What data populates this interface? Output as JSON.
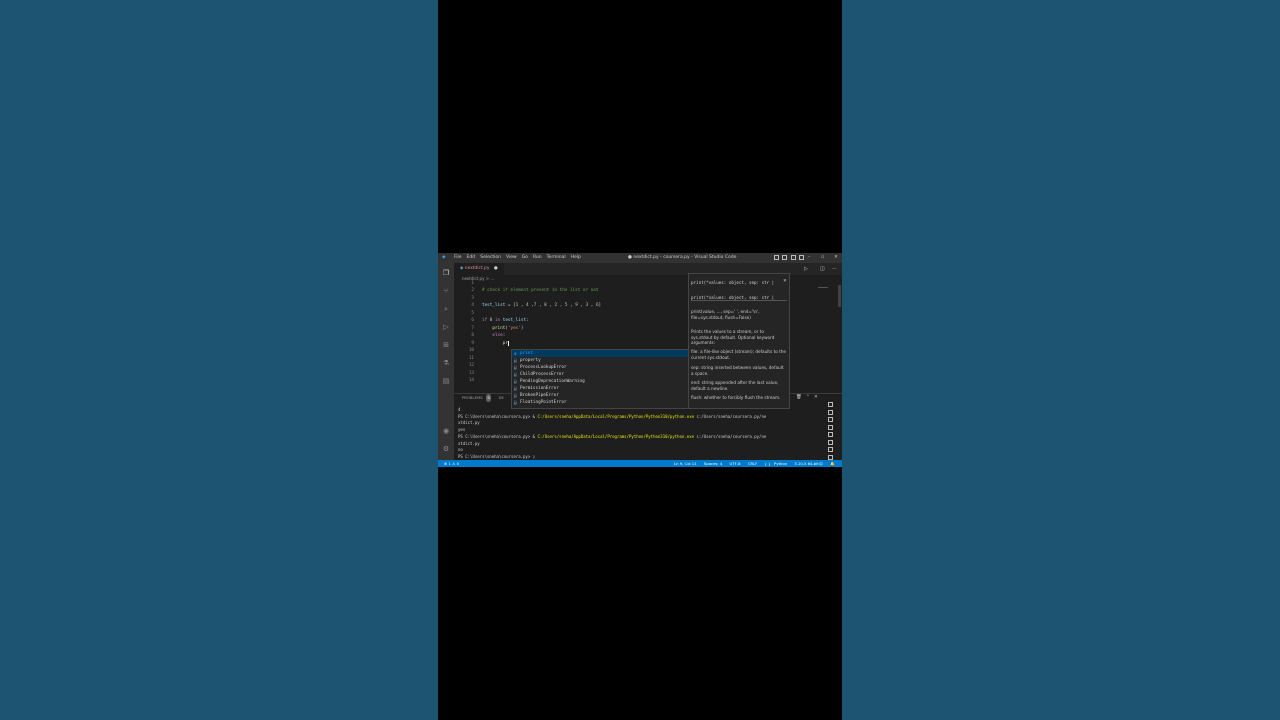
{
  "window": {
    "title": "● nextdict.py - coursera.py - Visual Studio Code",
    "menu": [
      "File",
      "Edit",
      "Selection",
      "View",
      "Go",
      "Run",
      "Terminal",
      "Help"
    ]
  },
  "tab": {
    "label": "nextdict.py"
  },
  "breadcrumb": "nextdict.py > ...",
  "editor": {
    "line_numbers": [
      "1",
      "2",
      "3",
      "4",
      "5",
      "6",
      "7",
      "8",
      "9",
      "10",
      "11",
      "12",
      "13",
      "14"
    ],
    "lines": [
      "",
      "# check if element present in the list or not",
      "",
      "test_list = [1 , 4 ,7 , 8 , 2 , 5 , 9 , 3 , 6]",
      "",
      "if 8 in test_list:",
      "    print('yes')",
      "    else:",
      "        pr",
      "",
      "",
      "",
      "",
      ""
    ]
  },
  "suggestions": {
    "items": [
      "print",
      "property",
      "ProcessLookupError",
      "ChildProcessError",
      "PendingDeprecationWarning",
      "PermissionError",
      "BrokenPipeError",
      "FloatingPointError"
    ]
  },
  "hover": {
    "signature_a": "print(*values: object, sep: str |",
    "signature_b": "print(*values: object, sep: str |",
    "doc_call": "print(value, ..., sep=' ', end='\\n', file=sys.stdout, flush=False)",
    "doc_body": "Prints the values to a stream, or to sys.stdout by default. Optional keyword arguments:",
    "doc_file": "file: a file-like object (stream); defaults to the current sys.stdout.",
    "doc_sep": "sep: string inserted between values, default a space.",
    "doc_end": "end: string appended after the last value, default a newline.",
    "doc_flush": "flush: whether to forcibly flush the stream."
  },
  "panel": {
    "tab_problems": "PROBLEMS",
    "problems_count": "0",
    "tab_debug": "DE",
    "terminal_lines": [
      {
        "pre": "4",
        "path": "",
        "post": ""
      },
      {
        "pre": "PS C:\\Users\\sneha\\coursera.py> & ",
        "path": "C:/Users/sneha/AppData/Local/Programs/Python/Python310/python.exe",
        "post": " c:/Users/sneha/coursera.py/ne"
      },
      {
        "pre": "xtdict.py",
        "path": "",
        "post": ""
      },
      {
        "pre": "yes",
        "path": "",
        "post": ""
      },
      {
        "pre": "PS C:\\Users\\sneha\\coursera.py> & ",
        "path": "C:/Users/sneha/AppData/Local/Programs/Python/Python310/python.exe",
        "post": " c:/Users/sneha/coursera.py/ne"
      },
      {
        "pre": "xtdict.py",
        "path": "",
        "post": ""
      },
      {
        "pre": "no",
        "path": "",
        "post": ""
      },
      {
        "pre": "PS C:\\Users\\sneha\\coursera.py> ▯",
        "path": "",
        "post": ""
      }
    ]
  },
  "status": {
    "problems": "⊗ 1 ⚠ 0",
    "position": "Ln 9, Col 11",
    "spaces": "Spaces: 4",
    "encoding": "UTF-8",
    "eol": "CRLF",
    "language_braces": "{ }",
    "language": "Python",
    "interpreter": "3.10.5 64-bit"
  },
  "icons": {
    "explorer": "explorer-icon",
    "scm": "source-control-icon",
    "search": "search-icon",
    "debug": "run-debug-icon",
    "extensions": "extensions-icon",
    "testing": "testing-icon",
    "account": "account-icon",
    "settings": "gear-icon"
  },
  "colors": {
    "accent": "#007acc",
    "tab_modified": "#d98b8b",
    "path_yellow": "#e5e510"
  }
}
